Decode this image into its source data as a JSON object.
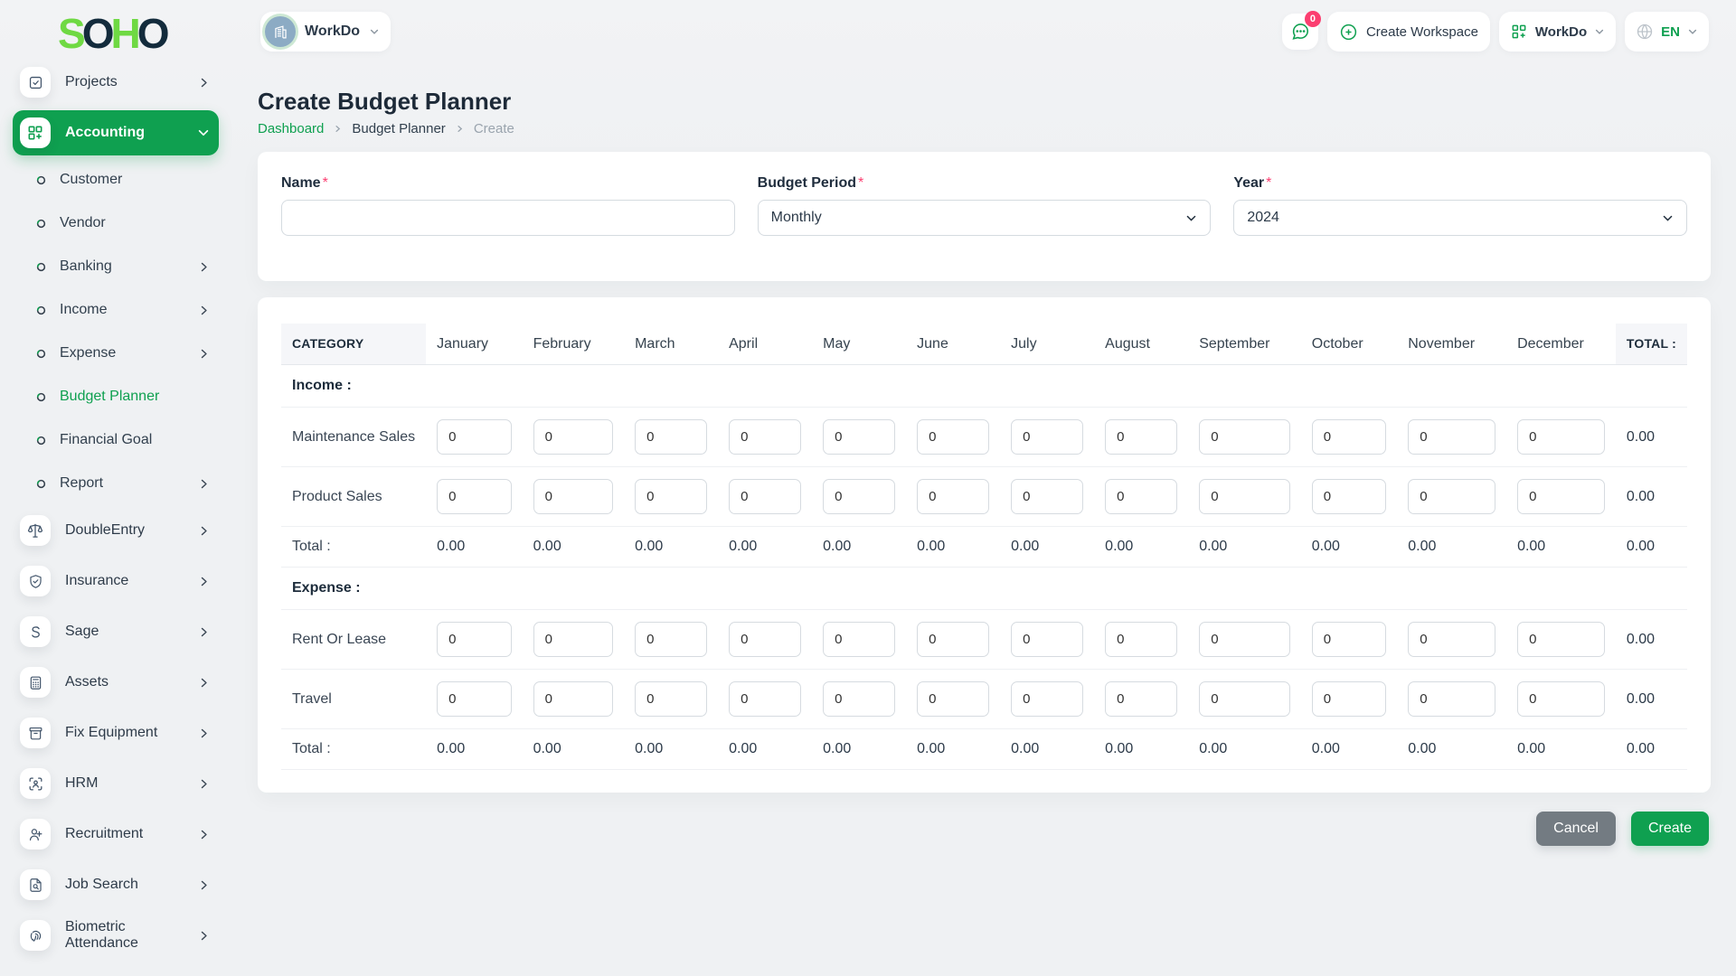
{
  "brand": {
    "name": "SOHO",
    "letters": [
      {
        "ch": "S",
        "color": "#6fd943"
      },
      {
        "ch": "O",
        "color": "#132b3c"
      },
      {
        "ch": "H",
        "color": "#6fd943"
      },
      {
        "ch": "O",
        "color": "#132b3c"
      }
    ]
  },
  "topbar": {
    "workspace": {
      "label": "WorkDo"
    },
    "chat": {
      "badge": "0"
    },
    "create_workspace": {
      "label": "Create Workspace"
    },
    "apps": {
      "label": "WorkDo"
    },
    "language": {
      "label": "EN"
    }
  },
  "sidebar": {
    "items": [
      {
        "label": "Projects",
        "icon": "checkbox",
        "chevron": "right"
      },
      {
        "label": "Accounting",
        "icon": "grid-plus",
        "chevron": "down",
        "active": true,
        "children": [
          {
            "label": "Customer"
          },
          {
            "label": "Vendor"
          },
          {
            "label": "Banking",
            "chevron": "right"
          },
          {
            "label": "Income",
            "chevron": "right"
          },
          {
            "label": "Expense",
            "chevron": "right"
          },
          {
            "label": "Budget Planner",
            "active": true
          },
          {
            "label": "Financial Goal"
          },
          {
            "label": "Report",
            "chevron": "right"
          }
        ]
      },
      {
        "label": "DoubleEntry",
        "icon": "scales",
        "chevron": "right"
      },
      {
        "label": "Insurance",
        "icon": "shield-check",
        "chevron": "right"
      },
      {
        "label": "Sage",
        "icon": "letter-s",
        "chevron": "right"
      },
      {
        "label": "Assets",
        "icon": "calculator",
        "chevron": "right"
      },
      {
        "label": "Fix Equipment",
        "icon": "archive",
        "chevron": "right"
      },
      {
        "label": "HRM",
        "icon": "person-frame",
        "chevron": "right"
      },
      {
        "label": "Recruitment",
        "icon": "person-plus",
        "chevron": "right"
      },
      {
        "label": "Job Search",
        "icon": "doc-search",
        "chevron": "right"
      },
      {
        "label": "Biometric Attendance",
        "icon": "fingerprint",
        "chevron": "right"
      }
    ]
  },
  "page": {
    "title": "Create Budget Planner",
    "breadcrumb": [
      {
        "label": "Dashboard",
        "type": "link"
      },
      {
        "label": "Budget Planner",
        "type": "normal"
      },
      {
        "label": "Create",
        "type": "muted"
      }
    ]
  },
  "form": {
    "name": {
      "label": "Name",
      "required": "*",
      "value": ""
    },
    "budget_period": {
      "label": "Budget Period",
      "required": "*",
      "value": "Monthly"
    },
    "year": {
      "label": "Year",
      "required": "*",
      "value": "2024"
    }
  },
  "budget_table": {
    "category_header": "CATEGORY",
    "months": [
      "January",
      "February",
      "March",
      "April",
      "May",
      "June",
      "July",
      "August",
      "September",
      "October",
      "November",
      "December"
    ],
    "total_header": "TOTAL :",
    "sections": [
      {
        "title": "Income :",
        "rows": [
          {
            "label": "Maintenance Sales",
            "values": [
              "0",
              "0",
              "0",
              "0",
              "0",
              "0",
              "0",
              "0",
              "0",
              "0",
              "0",
              "0"
            ],
            "total": "0.00"
          },
          {
            "label": "Product Sales",
            "values": [
              "0",
              "0",
              "0",
              "0",
              "0",
              "0",
              "0",
              "0",
              "0",
              "0",
              "0",
              "0"
            ],
            "total": "0.00"
          }
        ],
        "total_row": {
          "label": "Total :",
          "values": [
            "0.00",
            "0.00",
            "0.00",
            "0.00",
            "0.00",
            "0.00",
            "0.00",
            "0.00",
            "0.00",
            "0.00",
            "0.00",
            "0.00"
          ],
          "total": "0.00"
        }
      },
      {
        "title": "Expense :",
        "rows": [
          {
            "label": "Rent Or Lease",
            "values": [
              "0",
              "0",
              "0",
              "0",
              "0",
              "0",
              "0",
              "0",
              "0",
              "0",
              "0",
              "0"
            ],
            "total": "0.00"
          },
          {
            "label": "Travel",
            "values": [
              "0",
              "0",
              "0",
              "0",
              "0",
              "0",
              "0",
              "0",
              "0",
              "0",
              "0",
              "0"
            ],
            "total": "0.00"
          }
        ],
        "total_row": {
          "label": "Total :",
          "values": [
            "0.00",
            "0.00",
            "0.00",
            "0.00",
            "0.00",
            "0.00",
            "0.00",
            "0.00",
            "0.00",
            "0.00",
            "0.00",
            "0.00"
          ],
          "total": "0.00"
        }
      }
    ]
  },
  "actions": {
    "cancel": "Cancel",
    "create": "Create"
  },
  "colors": {
    "primary": "#0fa050",
    "logo_green": "#6fd943",
    "logo_dark": "#132b3c",
    "badge_pink": "#fb3e70"
  }
}
